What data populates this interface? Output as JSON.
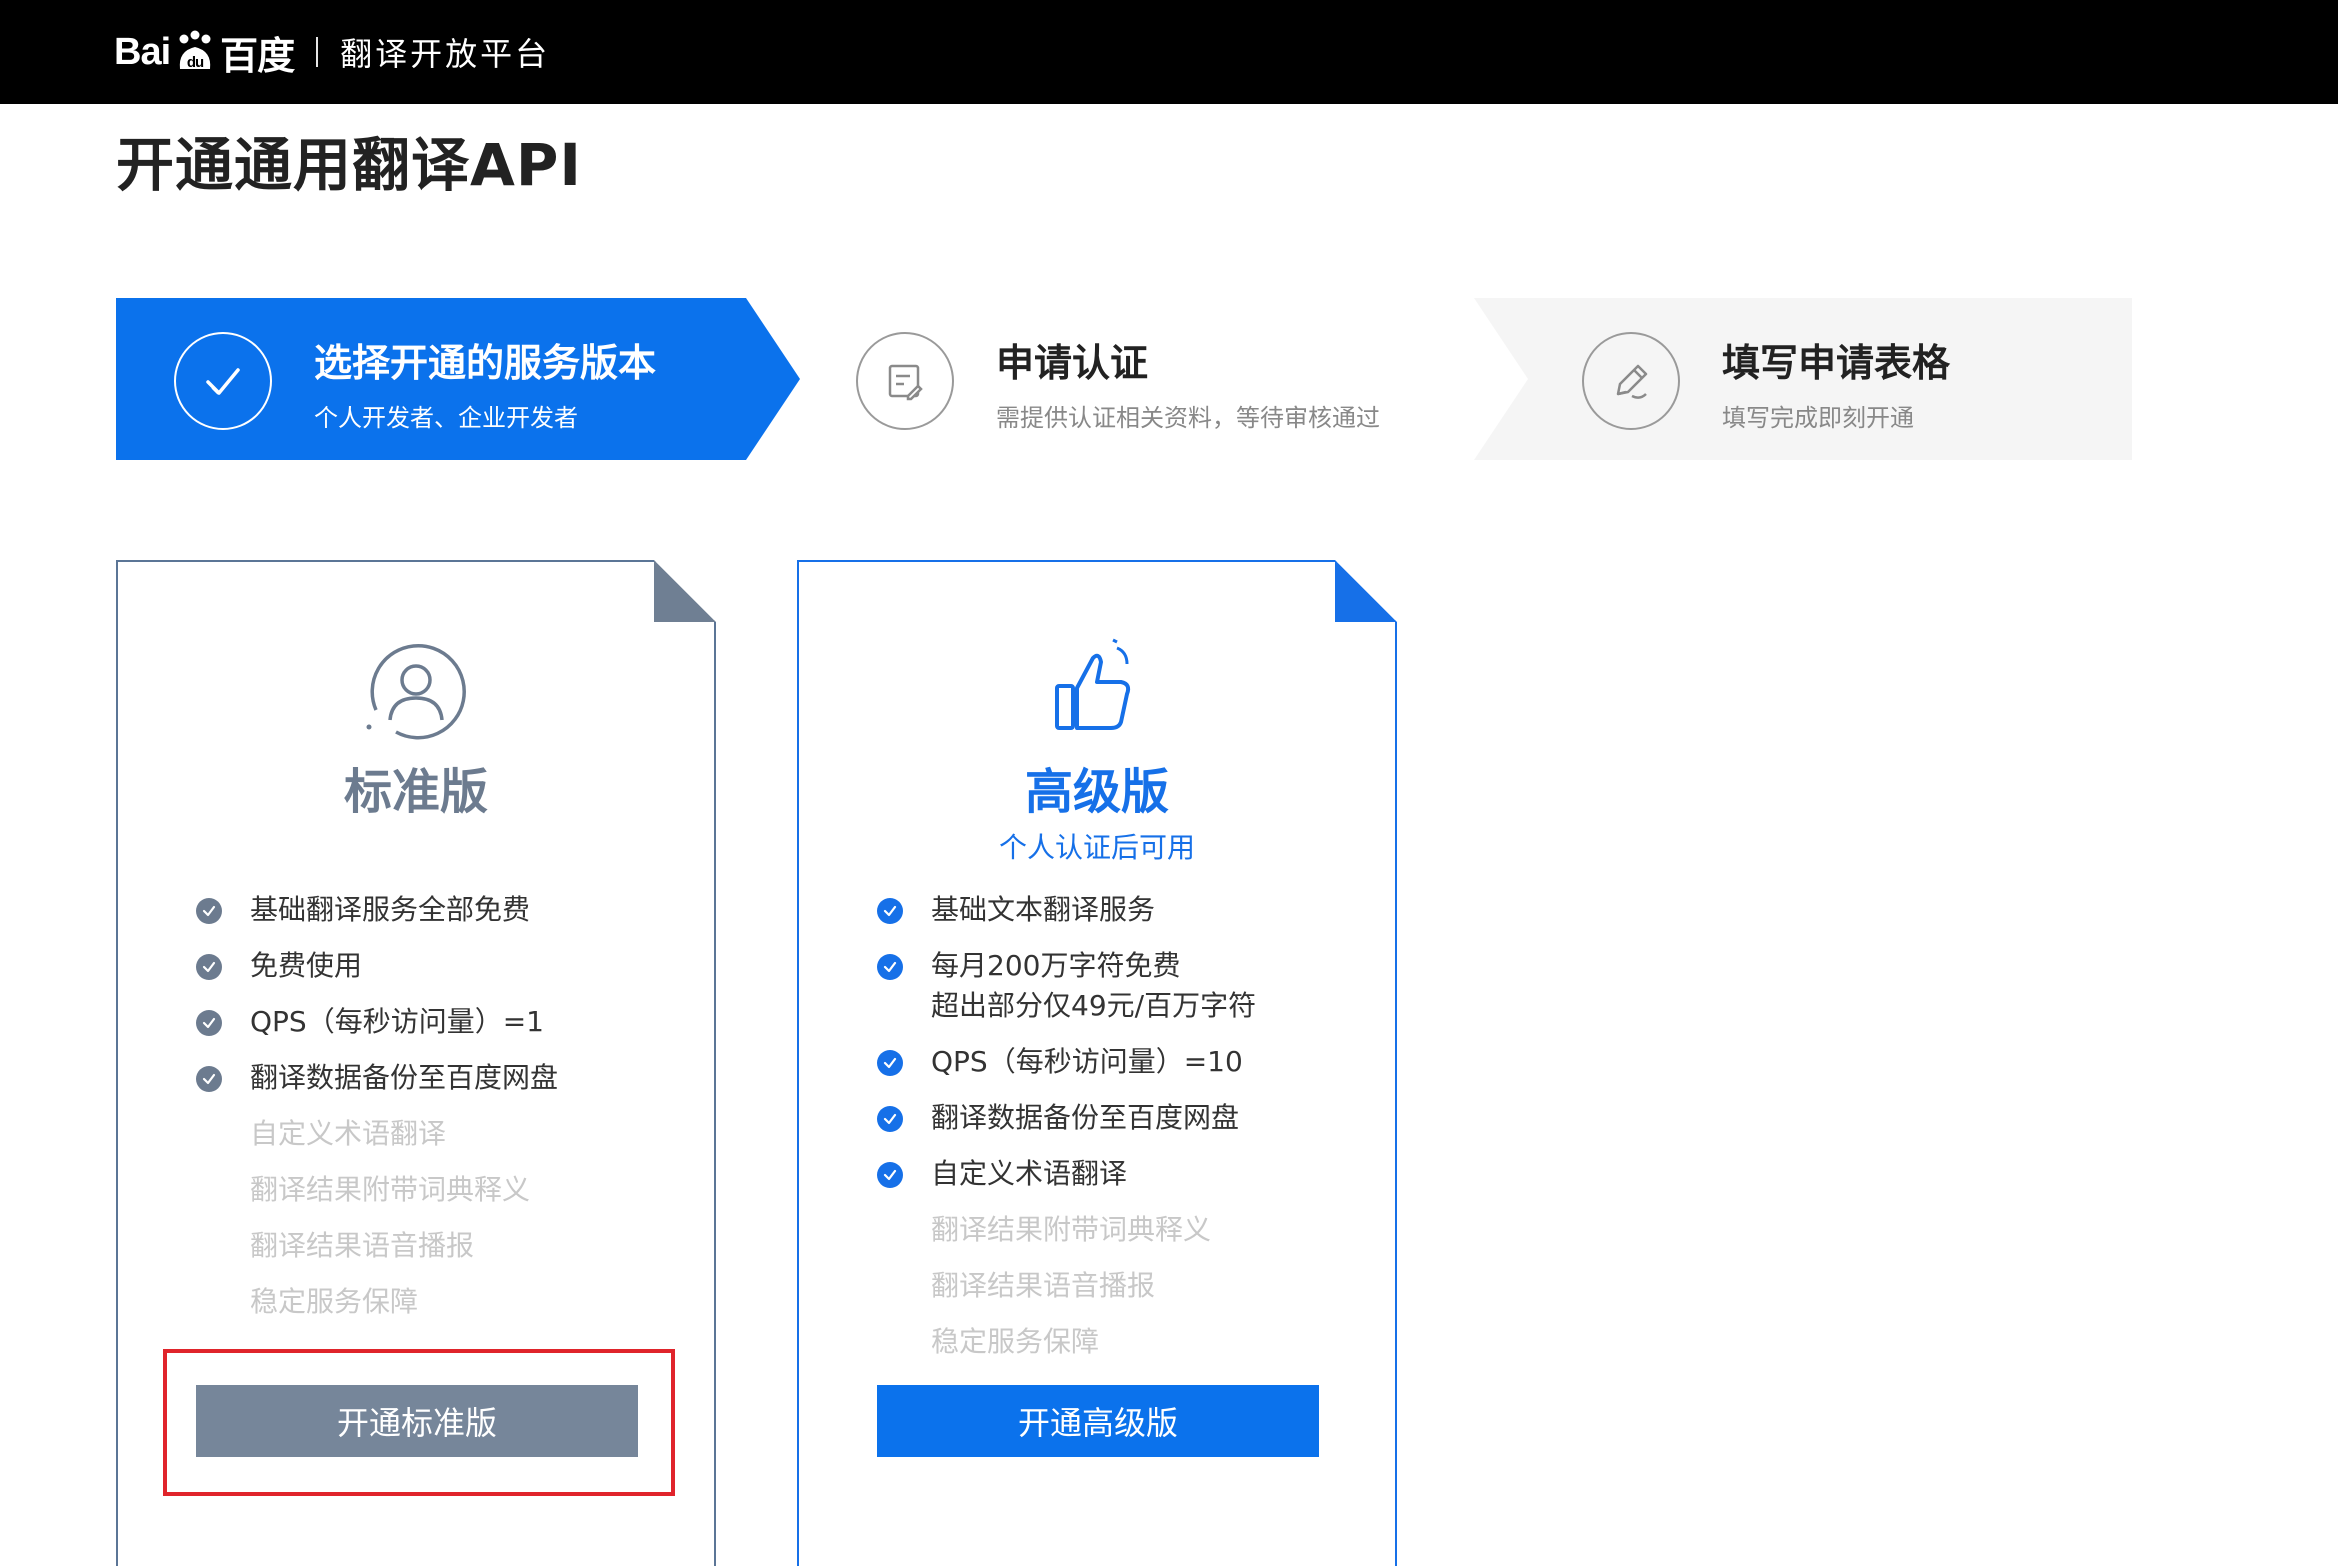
{
  "header": {
    "brand": "Bai",
    "brand_paw": "du",
    "brand_suffix": "百度",
    "platform": "翻译开放平台"
  },
  "page": {
    "title": "开通通用翻译API"
  },
  "steps": [
    {
      "title": "选择开通的服务版本",
      "subtitle": "个人开发者、企业开发者",
      "state": "active",
      "icon": "check-icon"
    },
    {
      "title": "申请认证",
      "subtitle": "需提供认证相关资料，等待审核通过",
      "state": "pending",
      "icon": "document-edit-icon"
    },
    {
      "title": "填写申请表格",
      "subtitle": "填写完成即刻开通",
      "state": "pending",
      "icon": "pencil-icon"
    }
  ],
  "plans": {
    "standard": {
      "name": "标准版",
      "note": "",
      "icon": "user-icon",
      "features": [
        {
          "lines": [
            "基础翻译服务全部免费"
          ],
          "included": true
        },
        {
          "lines": [
            "免费使用"
          ],
          "included": true
        },
        {
          "lines": [
            "QPS（每秒访问量）=1"
          ],
          "included": true
        },
        {
          "lines": [
            "翻译数据备份至百度网盘"
          ],
          "included": true
        },
        {
          "lines": [
            "自定义术语翻译"
          ],
          "included": false
        },
        {
          "lines": [
            "翻译结果附带词典释义"
          ],
          "included": false
        },
        {
          "lines": [
            "翻译结果语音播报"
          ],
          "included": false
        },
        {
          "lines": [
            "稳定服务保障"
          ],
          "included": false
        }
      ],
      "button": "开通标准版"
    },
    "premium": {
      "name": "高级版",
      "note": "个人认证后可用",
      "icon": "thumbs-up-icon",
      "features": [
        {
          "lines": [
            "基础文本翻译服务"
          ],
          "included": true
        },
        {
          "lines": [
            "每月200万字符免费",
            "超出部分仅49元/百万字符"
          ],
          "included": true
        },
        {
          "lines": [
            "QPS（每秒访问量）=10"
          ],
          "included": true
        },
        {
          "lines": [
            "翻译数据备份至百度网盘"
          ],
          "included": true
        },
        {
          "lines": [
            "自定义术语翻译"
          ],
          "included": true
        },
        {
          "lines": [
            "翻译结果附带词典释义"
          ],
          "included": false
        },
        {
          "lines": [
            "翻译结果语音播报"
          ],
          "included": false
        },
        {
          "lines": [
            "稳定服务保障"
          ],
          "included": false
        }
      ],
      "button": "开通高级版"
    }
  },
  "colors": {
    "accent": "#1670e8",
    "standard_accent": "#6c7b8f",
    "standard_button": "#76869a",
    "premium_button": "#0b72ec",
    "highlight": "#e0242b",
    "disabled_text": "#c8c8c8"
  }
}
